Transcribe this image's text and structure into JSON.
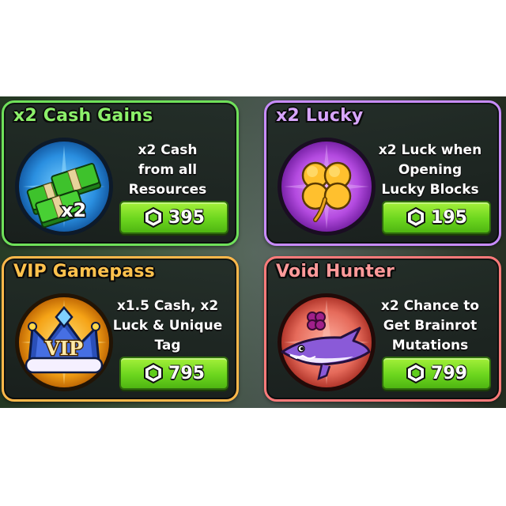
{
  "cards": [
    {
      "title": "x2 Cash Gains",
      "description": [
        "x2 Cash",
        "from all",
        "Resources"
      ],
      "price": "395",
      "icon": "cash-stack-icon",
      "icon_label": "x2",
      "accent": "#6fe15a"
    },
    {
      "title": "x2 Lucky",
      "description": [
        "x2 Luck when",
        "Opening",
        "Lucky Blocks"
      ],
      "price": "195",
      "icon": "clover-icon",
      "accent": "#c88cff"
    },
    {
      "title": "VIP Gamepass",
      "description": [
        "x1.5 Cash, x2",
        "Luck & Unique",
        "Tag"
      ],
      "price": "795",
      "icon": "vip-crown-icon",
      "icon_label": "VIP",
      "accent": "#ffb84a"
    },
    {
      "title": "Void Hunter",
      "description": [
        "x2 Chance to",
        "Get Brainrot",
        "Mutations"
      ],
      "price": "799",
      "icon": "shark-icon",
      "accent": "#ff7a7a"
    }
  ],
  "currency_icon": "robux-icon"
}
